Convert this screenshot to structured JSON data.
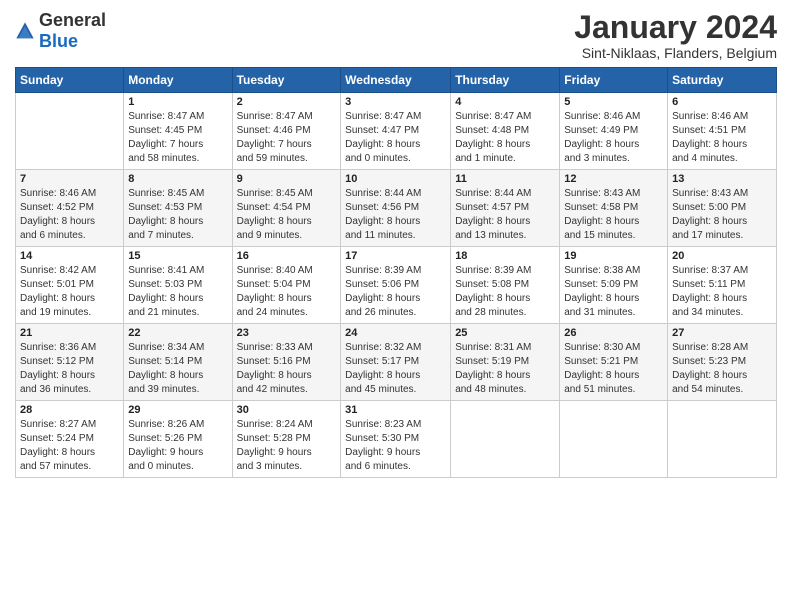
{
  "logo": {
    "general": "General",
    "blue": "Blue"
  },
  "header": {
    "title": "January 2024",
    "subtitle": "Sint-Niklaas, Flanders, Belgium"
  },
  "weekdays": [
    "Sunday",
    "Monday",
    "Tuesday",
    "Wednesday",
    "Thursday",
    "Friday",
    "Saturday"
  ],
  "weeks": [
    [
      {
        "day": "",
        "info": ""
      },
      {
        "day": "1",
        "info": "Sunrise: 8:47 AM\nSunset: 4:45 PM\nDaylight: 7 hours\nand 58 minutes."
      },
      {
        "day": "2",
        "info": "Sunrise: 8:47 AM\nSunset: 4:46 PM\nDaylight: 7 hours\nand 59 minutes."
      },
      {
        "day": "3",
        "info": "Sunrise: 8:47 AM\nSunset: 4:47 PM\nDaylight: 8 hours\nand 0 minutes."
      },
      {
        "day": "4",
        "info": "Sunrise: 8:47 AM\nSunset: 4:48 PM\nDaylight: 8 hours\nand 1 minute."
      },
      {
        "day": "5",
        "info": "Sunrise: 8:46 AM\nSunset: 4:49 PM\nDaylight: 8 hours\nand 3 minutes."
      },
      {
        "day": "6",
        "info": "Sunrise: 8:46 AM\nSunset: 4:51 PM\nDaylight: 8 hours\nand 4 minutes."
      }
    ],
    [
      {
        "day": "7",
        "info": "Sunrise: 8:46 AM\nSunset: 4:52 PM\nDaylight: 8 hours\nand 6 minutes."
      },
      {
        "day": "8",
        "info": "Sunrise: 8:45 AM\nSunset: 4:53 PM\nDaylight: 8 hours\nand 7 minutes."
      },
      {
        "day": "9",
        "info": "Sunrise: 8:45 AM\nSunset: 4:54 PM\nDaylight: 8 hours\nand 9 minutes."
      },
      {
        "day": "10",
        "info": "Sunrise: 8:44 AM\nSunset: 4:56 PM\nDaylight: 8 hours\nand 11 minutes."
      },
      {
        "day": "11",
        "info": "Sunrise: 8:44 AM\nSunset: 4:57 PM\nDaylight: 8 hours\nand 13 minutes."
      },
      {
        "day": "12",
        "info": "Sunrise: 8:43 AM\nSunset: 4:58 PM\nDaylight: 8 hours\nand 15 minutes."
      },
      {
        "day": "13",
        "info": "Sunrise: 8:43 AM\nSunset: 5:00 PM\nDaylight: 8 hours\nand 17 minutes."
      }
    ],
    [
      {
        "day": "14",
        "info": "Sunrise: 8:42 AM\nSunset: 5:01 PM\nDaylight: 8 hours\nand 19 minutes."
      },
      {
        "day": "15",
        "info": "Sunrise: 8:41 AM\nSunset: 5:03 PM\nDaylight: 8 hours\nand 21 minutes."
      },
      {
        "day": "16",
        "info": "Sunrise: 8:40 AM\nSunset: 5:04 PM\nDaylight: 8 hours\nand 24 minutes."
      },
      {
        "day": "17",
        "info": "Sunrise: 8:39 AM\nSunset: 5:06 PM\nDaylight: 8 hours\nand 26 minutes."
      },
      {
        "day": "18",
        "info": "Sunrise: 8:39 AM\nSunset: 5:08 PM\nDaylight: 8 hours\nand 28 minutes."
      },
      {
        "day": "19",
        "info": "Sunrise: 8:38 AM\nSunset: 5:09 PM\nDaylight: 8 hours\nand 31 minutes."
      },
      {
        "day": "20",
        "info": "Sunrise: 8:37 AM\nSunset: 5:11 PM\nDaylight: 8 hours\nand 34 minutes."
      }
    ],
    [
      {
        "day": "21",
        "info": "Sunrise: 8:36 AM\nSunset: 5:12 PM\nDaylight: 8 hours\nand 36 minutes."
      },
      {
        "day": "22",
        "info": "Sunrise: 8:34 AM\nSunset: 5:14 PM\nDaylight: 8 hours\nand 39 minutes."
      },
      {
        "day": "23",
        "info": "Sunrise: 8:33 AM\nSunset: 5:16 PM\nDaylight: 8 hours\nand 42 minutes."
      },
      {
        "day": "24",
        "info": "Sunrise: 8:32 AM\nSunset: 5:17 PM\nDaylight: 8 hours\nand 45 minutes."
      },
      {
        "day": "25",
        "info": "Sunrise: 8:31 AM\nSunset: 5:19 PM\nDaylight: 8 hours\nand 48 minutes."
      },
      {
        "day": "26",
        "info": "Sunrise: 8:30 AM\nSunset: 5:21 PM\nDaylight: 8 hours\nand 51 minutes."
      },
      {
        "day": "27",
        "info": "Sunrise: 8:28 AM\nSunset: 5:23 PM\nDaylight: 8 hours\nand 54 minutes."
      }
    ],
    [
      {
        "day": "28",
        "info": "Sunrise: 8:27 AM\nSunset: 5:24 PM\nDaylight: 8 hours\nand 57 minutes."
      },
      {
        "day": "29",
        "info": "Sunrise: 8:26 AM\nSunset: 5:26 PM\nDaylight: 9 hours\nand 0 minutes."
      },
      {
        "day": "30",
        "info": "Sunrise: 8:24 AM\nSunset: 5:28 PM\nDaylight: 9 hours\nand 3 minutes."
      },
      {
        "day": "31",
        "info": "Sunrise: 8:23 AM\nSunset: 5:30 PM\nDaylight: 9 hours\nand 6 minutes."
      },
      {
        "day": "",
        "info": ""
      },
      {
        "day": "",
        "info": ""
      },
      {
        "day": "",
        "info": ""
      }
    ]
  ]
}
